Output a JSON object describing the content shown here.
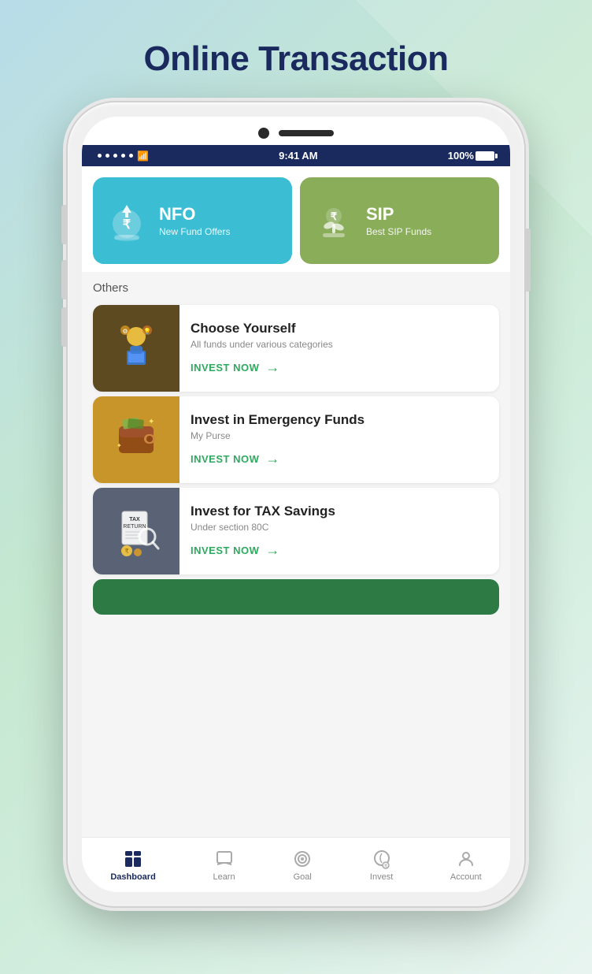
{
  "page": {
    "title": "Online Transaction",
    "background_colors": [
      "#b8dce8",
      "#c5e8d0"
    ]
  },
  "status_bar": {
    "time": "9:41 AM",
    "battery": "100%",
    "signal_dots": 5
  },
  "cards": {
    "nfo": {
      "title": "NFO",
      "subtitle": "New Fund Offers",
      "color": "#3bbdd4"
    },
    "sip": {
      "title": "SIP",
      "subtitle": "Best SIP Funds",
      "color": "#8aad5a"
    }
  },
  "sections": {
    "others_label": "Others"
  },
  "list_items": [
    {
      "title": "Choose Yourself",
      "description": "All funds under various categories",
      "cta": "INVEST NOW",
      "image_color": "brown"
    },
    {
      "title": "Invest in Emergency Funds",
      "description": "My Purse",
      "cta": "INVEST NOW",
      "image_color": "gold"
    },
    {
      "title": "Invest for TAX Savings",
      "description": "Under section 80C",
      "cta": "INVEST NOW",
      "image_color": "gray"
    }
  ],
  "bottom_nav": {
    "items": [
      {
        "label": "Dashboard",
        "icon": "dashboard-icon",
        "active": true
      },
      {
        "label": "Learn",
        "icon": "learn-icon",
        "active": false
      },
      {
        "label": "Goal",
        "icon": "goal-icon",
        "active": false
      },
      {
        "label": "Invest",
        "icon": "invest-icon",
        "active": false
      },
      {
        "label": "Account",
        "icon": "account-icon",
        "active": false
      }
    ]
  }
}
